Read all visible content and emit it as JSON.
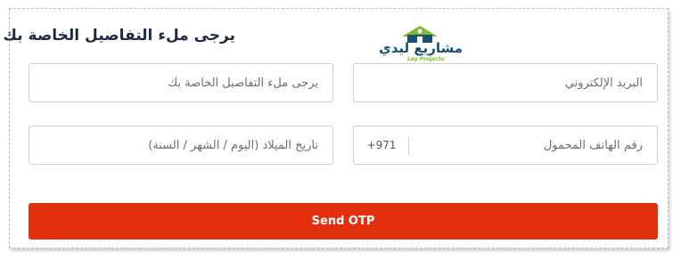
{
  "form": {
    "title": "يرجى ملء التفاصيل الخاصة بك",
    "email_placeholder": "البريد الإلكتروني",
    "details_placeholder": "يرجى ملء التفاصيل الخاصة بك",
    "phone_placeholder": "رقم الهاتف المحمول",
    "phone_country_code": "+971",
    "dob_placeholder": "تاريخ الميلاد (اليوم / الشهر / السنة)",
    "submit_label": "Send OTP"
  },
  "logo": {
    "text": "مشاريع ليدي",
    "subtext": "Lay Projects"
  },
  "colors": {
    "button": "#e2300f",
    "title": "#1f2a44",
    "logo_primary": "#1b4f72",
    "logo_accent": "#7dbb2c"
  },
  "icons": {
    "logo_mark": "house-icon"
  }
}
